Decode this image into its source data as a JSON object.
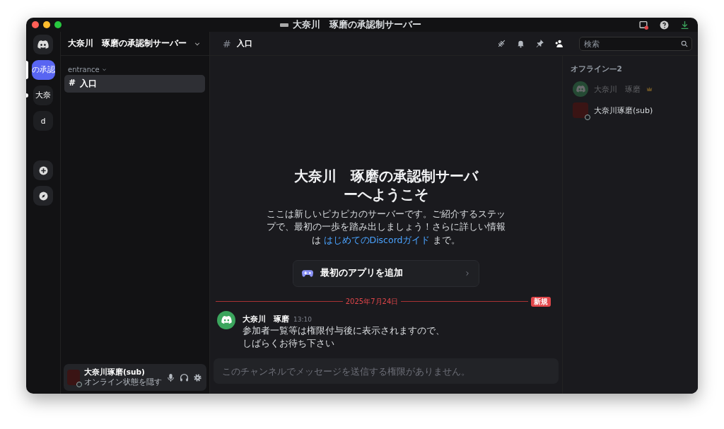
{
  "window": {
    "title": "大奈川　琢磨の承認制サーバー"
  },
  "servers": [
    {
      "label": "の承認",
      "selected": true
    },
    {
      "label": "大奈",
      "selected": false,
      "unread": true
    },
    {
      "label": "d",
      "selected": false
    }
  ],
  "server_header": {
    "name": "大奈川　琢磨の承認制サーバー"
  },
  "categories": [
    {
      "name": "entrance",
      "channels": [
        {
          "name": "入口",
          "selected": true
        }
      ]
    }
  ],
  "channel_header": {
    "hash": "#",
    "name": "入口",
    "search_placeholder": "検索"
  },
  "welcome": {
    "title": "大奈川　琢磨の承認制サーバーへようこそ",
    "text": "ここは新しいピカピカのサーバーです。ご紹介するステップで、最初の一歩を踏み出しましょう！さらに詳しい情報は ",
    "link": "はじめてのDiscordガイド",
    "text_end": " まで。",
    "action": "最初のアプリを追加"
  },
  "divider": {
    "date": "2025年7月24日",
    "badge": "新規"
  },
  "messages": [
    {
      "author": "大奈川　琢磨",
      "time": "13:10",
      "lines": [
        "参加者一覧等は権限付与後に表示されますので、",
        "しばらくお待ち下さい"
      ]
    }
  ],
  "composer": {
    "placeholder": "このチャンネルでメッセージを送信する権限がありません。"
  },
  "user_panel": {
    "name": "大奈川琢磨(sub)",
    "status": "オンライン状態を隠す"
  },
  "members": {
    "group": "オフライン—2",
    "list": [
      {
        "name": "大奈川　琢磨",
        "owner": true,
        "kind": "discord"
      },
      {
        "name": "大奈川琢磨(sub)",
        "owner": false,
        "kind": "photo"
      }
    ]
  }
}
